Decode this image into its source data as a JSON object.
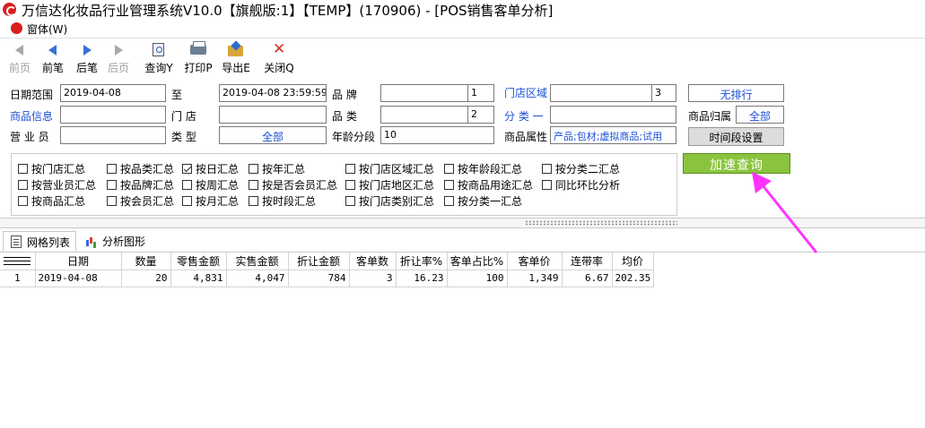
{
  "title": "万信达化妆品行业管理系统V10.0【旗舰版:1】【TEMP】(170906) - [POS销售客单分析]",
  "menu": {
    "window": "窗体(W)"
  },
  "toolbar": {
    "prev_page": "前页",
    "prev": "前笔",
    "next": "后笔",
    "last_page": "后页",
    "query": "查询Y",
    "print": "打印P",
    "export": "导出E",
    "close": "关闭Q"
  },
  "filters": {
    "date_range_label": "日期范围",
    "date_from": "2019-04-08",
    "to_label": "至",
    "date_to": "2019-04-08 23:59:59",
    "brand_label": "品    牌",
    "brand_num": "1",
    "store_area_label": "门店区域",
    "store_area_num": "3",
    "sort_value": "无排行",
    "product_info_label": "商品信息",
    "store_label": "门    店",
    "category_label": "品    类",
    "category_num": "2",
    "category1_label": "分 类 一",
    "product_owner_label": "商品归属",
    "product_owner_value": "全部",
    "clerk_label": "营 业 员",
    "type_label": "类    型",
    "type_value": "全部",
    "age_group_label": "年龄分段",
    "age_group_value": "10",
    "product_attr_label": "商品属性",
    "product_attr_value": "产品;包材;虚拟商品;试用",
    "time_setting_button": "时间段设置",
    "quick_query_button": "加速查询"
  },
  "checkboxes": [
    {
      "label": "按门店汇总",
      "checked": false
    },
    {
      "label": "按品类汇总",
      "checked": false
    },
    {
      "label": "按日汇总",
      "checked": true
    },
    {
      "label": "按年汇总",
      "checked": false
    },
    {
      "label": "按门店区域汇总",
      "checked": false
    },
    {
      "label": "按年龄段汇总",
      "checked": false
    },
    {
      "label": "按分类二汇总",
      "checked": false
    },
    {
      "label": "按营业员汇总",
      "checked": false
    },
    {
      "label": "按品牌汇总",
      "checked": false
    },
    {
      "label": "按周汇总",
      "checked": false
    },
    {
      "label": "按是否会员汇总",
      "checked": false
    },
    {
      "label": "按门店地区汇总",
      "checked": false
    },
    {
      "label": "按商品用途汇总",
      "checked": false
    },
    {
      "label": "同比环比分析",
      "checked": false
    },
    {
      "label": "按商品汇总",
      "checked": false
    },
    {
      "label": "按会员汇总",
      "checked": false
    },
    {
      "label": "按月汇总",
      "checked": false
    },
    {
      "label": "按时段汇总",
      "checked": false
    },
    {
      "label": "按门店类别汇总",
      "checked": false
    },
    {
      "label": "按分类一汇总",
      "checked": false
    }
  ],
  "tabs": [
    {
      "label": "网格列表",
      "icon": "grid-list-icon"
    },
    {
      "label": "分析图形",
      "icon": "bar-chart-icon"
    }
  ],
  "table": {
    "headers": [
      "日期",
      "数量",
      "零售金额",
      "实售金额",
      "折让金额",
      "客单数",
      "折让率%",
      "客单占比%",
      "客单价",
      "连带率",
      "均价"
    ],
    "rows": [
      {
        "index": "1",
        "cells": [
          "2019-04-08",
          "20",
          "4,831",
          "4,047",
          "784",
          "3",
          "16.23",
          "100",
          "1,349",
          "6.67",
          "202.35"
        ]
      }
    ]
  },
  "colors": {
    "accent_blue": "#1a4fd8",
    "quick_button_green": "#8ac43f",
    "annotation_arrow": "#ff33ff",
    "logo_red": "#d81e1e"
  }
}
